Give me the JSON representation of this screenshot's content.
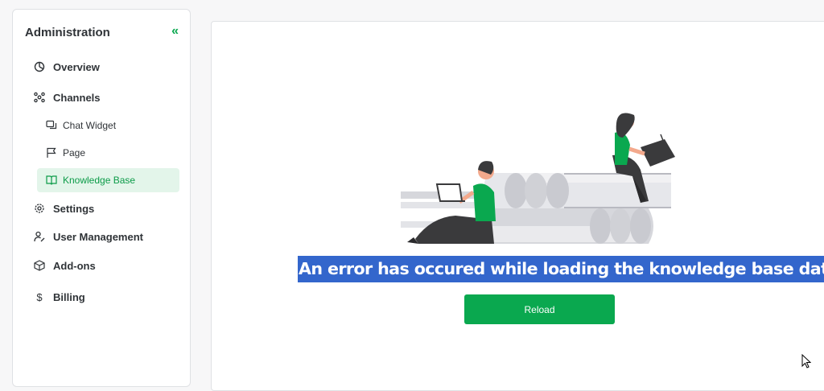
{
  "sidebar": {
    "title": "Administration",
    "collapse_icon": "double-chevron-left-icon",
    "items": {
      "overview": {
        "label": "Overview",
        "icon": "overview-icon"
      },
      "channels": {
        "label": "Channels",
        "icon": "channels-icon"
      },
      "chat_widget": {
        "label": "Chat Widget",
        "icon": "chat-icon"
      },
      "page": {
        "label": "Page",
        "icon": "flag-icon"
      },
      "knowledge_base": {
        "label": "Knowledge Base",
        "icon": "book-icon",
        "active": true
      },
      "settings": {
        "label": "Settings",
        "icon": "gear-icon"
      },
      "user_management": {
        "label": "User Management",
        "icon": "user-edit-icon"
      },
      "addons": {
        "label": "Add-ons",
        "icon": "box-icon"
      },
      "billing": {
        "label": "Billing",
        "icon": "dollar-icon"
      }
    }
  },
  "main": {
    "error_message": "An error has occured while loading the knowledge base data.",
    "reload_label": "Reload"
  },
  "colors": {
    "accent": "#0aa84f",
    "active_bg": "#e3f5ea",
    "selection": "#3366cc"
  }
}
